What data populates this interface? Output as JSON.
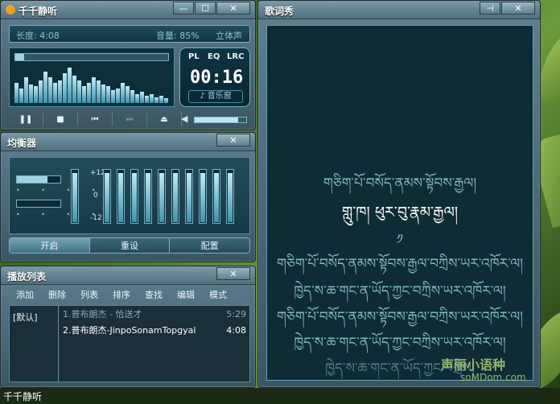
{
  "player": {
    "title": "千千静听",
    "min_btn": "—",
    "max_btn": "☐",
    "close_btn": "✕",
    "length_label": "长度: 4:08",
    "volume_label": "音量: 85%",
    "stereo_label": "立体声",
    "mode_pl": "PL",
    "mode_eq": "EQ",
    "mode_lrc": "LRC",
    "time": "00:16",
    "music_window": "♪ 音乐窗",
    "progress_fraction": 0.06,
    "volume_fraction": 0.85,
    "controls": [
      "pause-icon",
      "stop-icon",
      "prev-icon",
      "next-icon",
      "eject-icon"
    ],
    "spectrum": [
      0.55,
      0.4,
      0.7,
      0.5,
      0.45,
      0.6,
      0.85,
      0.7,
      0.55,
      0.6,
      0.8,
      0.95,
      0.75,
      0.6,
      0.45,
      0.55,
      0.7,
      0.6,
      0.5,
      0.45,
      0.35,
      0.4,
      0.55,
      0.45,
      0.35,
      0.25,
      0.3,
      0.2,
      0.25,
      0.15,
      0.2,
      0.12
    ]
  },
  "equalizer": {
    "title": "均衡器",
    "close_btn": "✕",
    "label_plus12": "+12",
    "label_0": "0",
    "label_minus12": "-12",
    "band_levels": [
      0.92,
      0.92,
      0.92,
      0.92,
      0.92,
      0.92,
      0.92,
      0.92,
      0.92,
      0.92
    ],
    "btn_on": "开启",
    "btn_reset": "重设",
    "btn_config": "配置"
  },
  "playlist": {
    "title": "播放列表",
    "close_btn": "✕",
    "menu": [
      "添加",
      "删除",
      "列表",
      "排序",
      "查找",
      "编辑",
      "模式"
    ],
    "group": "[默认]",
    "items": [
      {
        "name": "1.普布朗杰 - 恰送才",
        "duration": "5:29"
      },
      {
        "name": "2.普布朗杰-JinpoSonamTopgyal",
        "duration": "4:08"
      }
    ]
  },
  "lyrics": {
    "title": "歌词秀",
    "pin_btn": "⊣",
    "close_btn": "✕",
    "lines": [
      "གཅིག་པོ་བསོད་ནམས་སྟོབས་རྒྱལ།",
      "གླུ་ཁ། ཕུར་བུ་རྣམ་རྒྱལ།",
      "༡",
      "གཅིག་པོ་བསོད་ནམས་སྟོབས་རྒྱལ་བཀྲིས་ཡར་འཁོར་ལ།",
      "ཁྱེད་ས་ཆ་གང་ན་ཡོད་ཀྱང་བཀྲིས་ཡར་འཁོར་ལ།",
      "གཅིག་པོ་བསོད་ནམས་སྟོབས་རྒྱལ་བཀྲིས་ཡར་འཁོར་ལ།",
      "ཁྱེད་ས་ཆ་གང་ན་ཡོད་ཀྱང་བཀྲིས་ཡར་འཁོར་ལ།",
      "ཁྱེད་ས་ཆ་གང་ན་ཡོད་ཀྱང་བཀྲིས།"
    ]
  },
  "watermark": "声丽小语种",
  "watermark_url": "soMDom.com",
  "taskbar_label": "千千静听"
}
